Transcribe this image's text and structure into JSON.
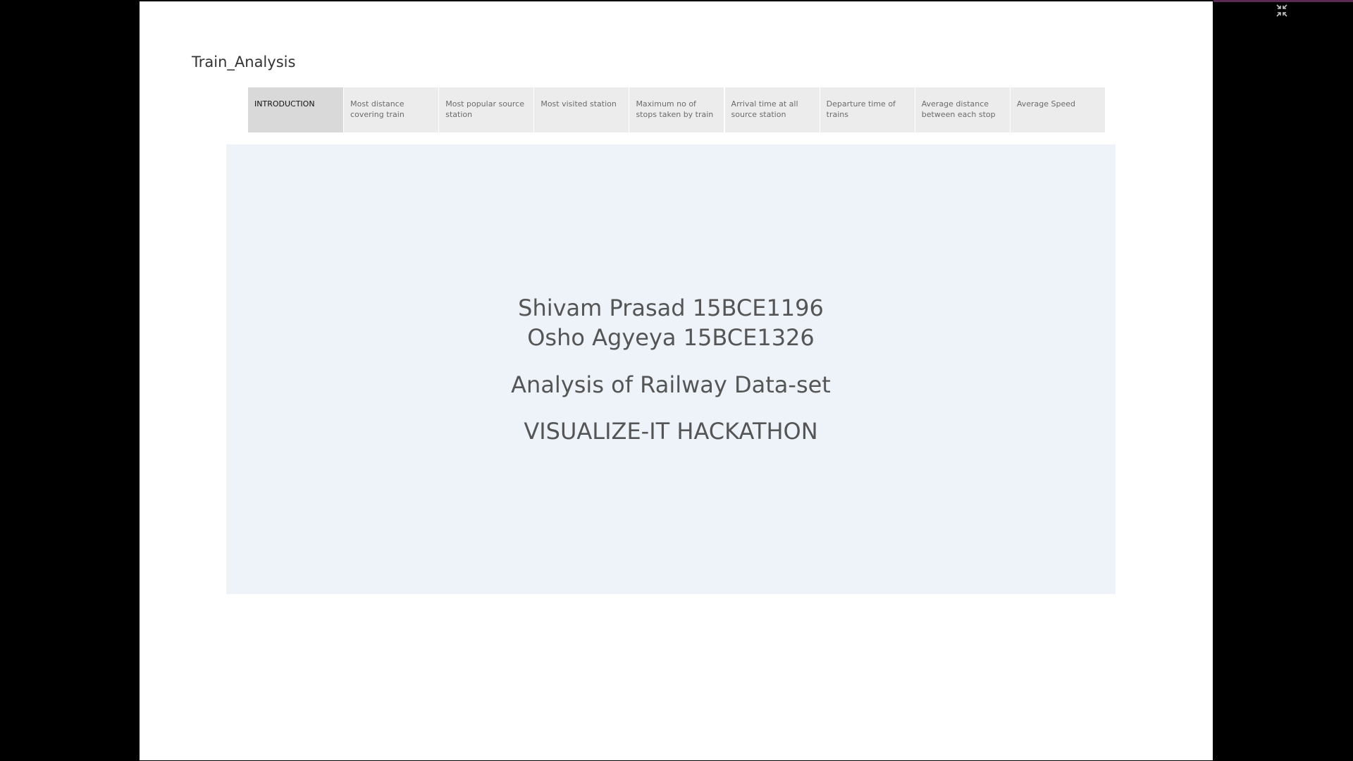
{
  "dashboard": {
    "title": "Train_Analysis"
  },
  "tabs": [
    {
      "label": "INTRODUCTION",
      "active": true
    },
    {
      "label": "Most distance covering train",
      "active": false
    },
    {
      "label": "Most popular source station",
      "active": false
    },
    {
      "label": "Most visited station",
      "active": false
    },
    {
      "label": "Maximum no of stops taken by train",
      "active": false
    },
    {
      "label": "Arrival time at all source station",
      "active": false
    },
    {
      "label": "Departure time of trains",
      "active": false
    },
    {
      "label": "Average distance between each stop",
      "active": false
    },
    {
      "label": "Average Speed",
      "active": false
    }
  ],
  "content": {
    "authors": [
      "Shivam Prasad 15BCE1196",
      "Osho Agyeya 15BCE1326"
    ],
    "subtitle": "Analysis of Railway Data-set",
    "event": "VISUALIZE-IT HACKATHON"
  },
  "toolbar": {
    "exit_fullscreen_icon": "exit-fullscreen-icon"
  },
  "colors": {
    "page_background": "#000000",
    "stage_background": "#ffffff",
    "tab_background": "#ececec",
    "tab_active_background": "#d9d9d9",
    "panel_background": "#eef2f9",
    "text": "#555555",
    "accent": "#5a2a52"
  }
}
